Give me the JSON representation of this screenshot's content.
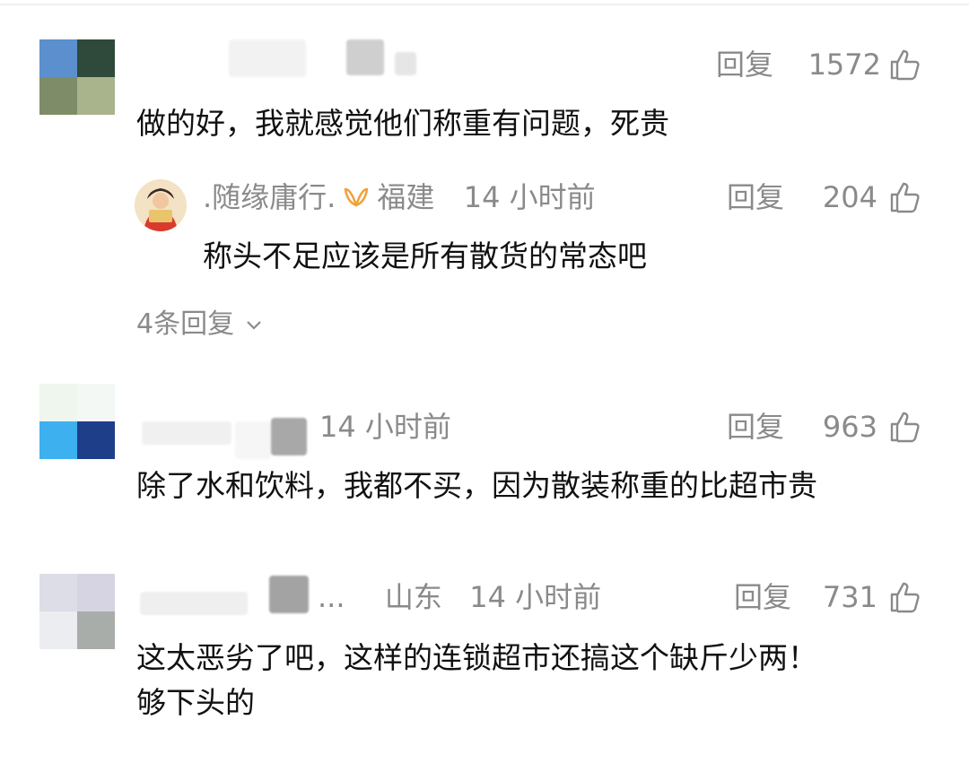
{
  "comments": [
    {
      "content": "做的好，我就感觉他们称重有问题，死贵",
      "reply_label": "回复",
      "likes": "1572",
      "avatar_colors": [
        "#5b8fce",
        "#2f4a3a",
        "#7e8c68",
        "#a9b48d"
      ],
      "reply": {
        "username": ".随缘庸行.",
        "location": "福建",
        "time": "14 小时前",
        "reply_label": "回复",
        "likes": "204",
        "content": "称头不足应该是所有散货的常态吧"
      },
      "more_replies": "4条回复"
    },
    {
      "time": "14 小时前",
      "content": "除了水和饮料，我都不买，因为散装称重的比超市贵",
      "reply_label": "回复",
      "likes": "963",
      "avatar_colors": [
        "#eef6ee",
        "#f4f8f4",
        "#3db1f0",
        "#1f3e8a"
      ]
    },
    {
      "name_suffix": "...",
      "location": "山东",
      "time": "14 小时前",
      "content_line1": "这太恶劣了吧，这样的连锁超市还搞这个缺斤少两！",
      "content_line2": "够下头的",
      "reply_label": "回复",
      "likes": "731",
      "avatar_colors": [
        "#dcdde6",
        "#d6d4e2",
        "#ecedf0",
        "#a9ada9"
      ]
    }
  ],
  "colors": {
    "meta": "#8a8a8a",
    "text": "#111111",
    "badge": "#f0a23a"
  },
  "icons": {
    "like": "thumbs-up-icon",
    "chevron": "chevron-down-icon",
    "badge": "vip-badge-icon"
  }
}
